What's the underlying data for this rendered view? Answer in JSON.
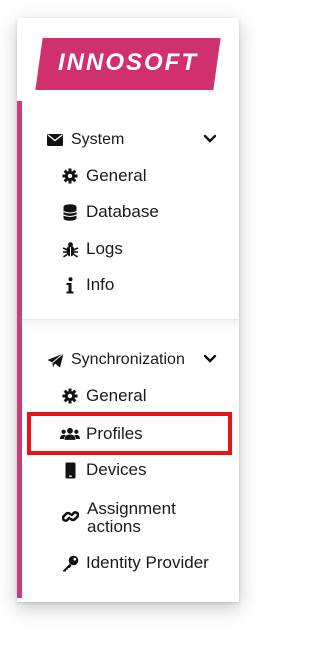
{
  "brand": {
    "name": "INNOSOFT",
    "color": "#d1306e"
  },
  "sections": [
    {
      "label": "System",
      "icon": "envelope-icon",
      "items": [
        {
          "label": "General",
          "icon": "gear-icon"
        },
        {
          "label": "Database",
          "icon": "database-icon"
        },
        {
          "label": "Logs",
          "icon": "bug-icon"
        },
        {
          "label": "Info",
          "icon": "info-icon"
        }
      ]
    },
    {
      "label": "Synchronization",
      "icon": "paper-plane-icon",
      "items": [
        {
          "label": "General",
          "icon": "gear-icon"
        },
        {
          "label": "Profiles",
          "icon": "users-icon",
          "highlighted": true
        },
        {
          "label": "Devices",
          "icon": "device-icon"
        },
        {
          "label": "Assignment actions",
          "icon": "link-icon"
        },
        {
          "label": "Identity Provider",
          "icon": "key-icon"
        }
      ]
    }
  ],
  "colors": {
    "accent": "#c63f7a",
    "highlight_border": "#e81518"
  }
}
